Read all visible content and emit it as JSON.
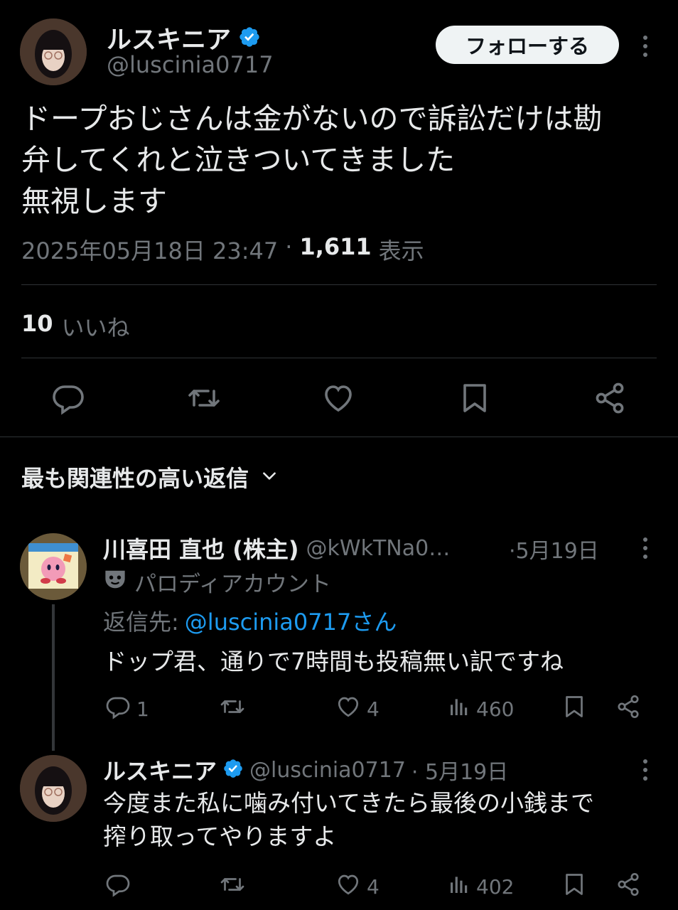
{
  "main_tweet": {
    "display_name": "ルスキニア",
    "handle": "@luscinia0717",
    "follow_label": "フォローする",
    "text_lines": [
      "ドープおじさんは金がないので訴訟だけは勘",
      "弁してくれと泣きついてきました",
      "無視します"
    ],
    "timestamp": "2025年05月18日 23:47",
    "separator": "·",
    "views_count": "1,611",
    "views_label": "表示",
    "likes_count": "10",
    "likes_label": "いいね"
  },
  "replies_header": {
    "label": "最も関連性の高い返信"
  },
  "reply1": {
    "display_name": "川喜田 直也 (株主)",
    "handle": "@kWkTNa0…",
    "date": "·5月19日",
    "badge_text": "パロディアカウント",
    "reply_to_label": "返信先:",
    "reply_to_handle": "@luscinia0717さん",
    "text": "ドップ君、通りで7時間も投稿無い訳ですね",
    "reply_count": "1",
    "like_count": "4",
    "view_count": "460"
  },
  "reply2": {
    "display_name": "ルスキニア",
    "handle": "@luscinia0717",
    "date": "· 5月19日",
    "text_lines": [
      "今度また私に噛み付いてきたら最後の小銭まで",
      "搾り取ってやりますよ"
    ],
    "like_count": "4",
    "view_count": "402"
  },
  "colors": {
    "background": "#000000",
    "text": "#e7e9ea",
    "muted": "#71767b",
    "accent": "#1d9bf0",
    "divider": "#2f3336"
  },
  "icons": [
    "verified-badge-icon",
    "more-icon",
    "reply-icon",
    "repost-icon",
    "like-icon",
    "bookmark-icon",
    "share-icon",
    "views-icon",
    "chevron-down-icon",
    "parody-mask-icon"
  ]
}
